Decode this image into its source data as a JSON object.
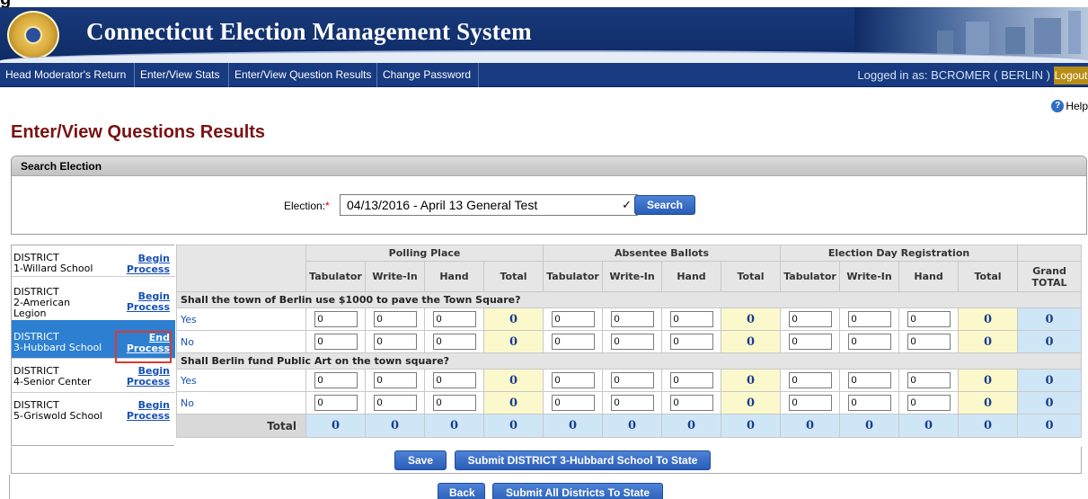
{
  "app": {
    "title": "Connecticut Election Management System",
    "nav": [
      {
        "label": "Head Moderator's Return"
      },
      {
        "label": "Enter/View Stats"
      },
      {
        "label": "Enter/View Question Results"
      },
      {
        "label": "Change Password"
      }
    ],
    "logged_in": "Logged in as: BCROMER ( BERLIN )",
    "logout_label": "Logout",
    "help_label": "Help"
  },
  "page": {
    "title": "Enter/View Questions Results"
  },
  "search": {
    "header": "Search Election",
    "election_label": "Election:",
    "required_mark": "*",
    "election_value": "04/13/2016 - April 13 General Test",
    "search_button": "Search"
  },
  "districts": [
    {
      "name_line1": "DISTRICT",
      "name_line2": "1-Willard School",
      "action_line1": "Begin",
      "action_line2": "Process",
      "selected": false
    },
    {
      "name_line1": "DISTRICT",
      "name_line2": "2-American",
      "name_line3": "Legion",
      "action_line1": "Begin",
      "action_line2": "Process",
      "selected": false
    },
    {
      "name_line1": "DISTRICT",
      "name_line2": "3-Hubbard School",
      "action_line1": "End",
      "action_line2": "Process",
      "selected": true
    },
    {
      "name_line1": "DISTRICT",
      "name_line2": "4-Senior Center",
      "action_line1": "Begin",
      "action_line2": "Process",
      "selected": false
    },
    {
      "name_line1": "DISTRICT",
      "name_line2": "5-Griswold School",
      "action_line1": "Begin",
      "action_line2": "Process",
      "selected": false
    }
  ],
  "table": {
    "groups": [
      "Polling Place",
      "Absentee Ballots",
      "Election Day Registration"
    ],
    "columns": [
      "Tabulator",
      "Write-In",
      "Hand",
      "Total"
    ],
    "grand_total_line1": "Grand",
    "grand_total_line2": "TOTAL",
    "questions": [
      {
        "text": "Shall the town of Berlin use $1000 to pave the Town Square?",
        "answers": [
          {
            "label": "Yes",
            "values": [
              "0",
              "0",
              "0",
              "0",
              "0",
              "0",
              "0",
              "0",
              "0",
              "0",
              "0",
              "0",
              "0"
            ]
          },
          {
            "label": "No",
            "values": [
              "0",
              "0",
              "0",
              "0",
              "0",
              "0",
              "0",
              "0",
              "0",
              "0",
              "0",
              "0",
              "0"
            ]
          }
        ]
      },
      {
        "text": "Shall Berlin fund Public Art on the town square?",
        "answers": [
          {
            "label": "Yes",
            "values": [
              "0",
              "0",
              "0",
              "0",
              "0",
              "0",
              "0",
              "0",
              "0",
              "0",
              "0",
              "0",
              "0"
            ]
          },
          {
            "label": "No",
            "values": [
              "0",
              "0",
              "0",
              "0",
              "0",
              "0",
              "0",
              "0",
              "0",
              "0",
              "0",
              "0",
              "0"
            ]
          }
        ]
      }
    ],
    "total_label": "Total",
    "totals": [
      "0",
      "0",
      "0",
      "0",
      "0",
      "0",
      "0",
      "0",
      "0",
      "0",
      "0",
      "0",
      "0"
    ]
  },
  "actions": {
    "save": "Save",
    "submit_district": "Submit DISTRICT 3-Hubbard School To State",
    "back": "Back",
    "submit_all": "Submit All Districts To State"
  },
  "colors": {
    "header_bg": "#18397a",
    "title_color": "#7a1212",
    "selected_row": "#2c7fd1",
    "total_cell": "#fbf9cc",
    "grand_cell": "#cfe6f7",
    "button": "#2a5eb8"
  }
}
